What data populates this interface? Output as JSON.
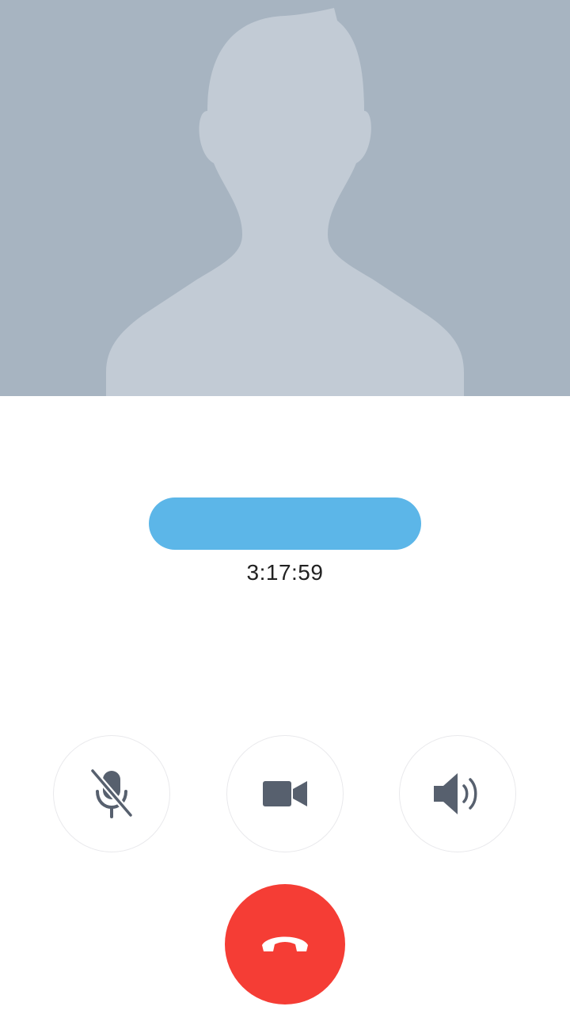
{
  "call": {
    "timer": "3:17:59",
    "contact_name_redacted": true
  },
  "controls": {
    "mute_icon": "microphone-muted-icon",
    "video_icon": "video-camera-icon",
    "speaker_icon": "speaker-volume-icon",
    "end_call_icon": "phone-hangup-icon"
  },
  "colors": {
    "avatar_background": "#a7b4c1",
    "avatar_silhouette": "#c2cbd5",
    "name_redaction": "#5cb6e8",
    "icon": "#57606e",
    "end_call": "#f53d35"
  }
}
